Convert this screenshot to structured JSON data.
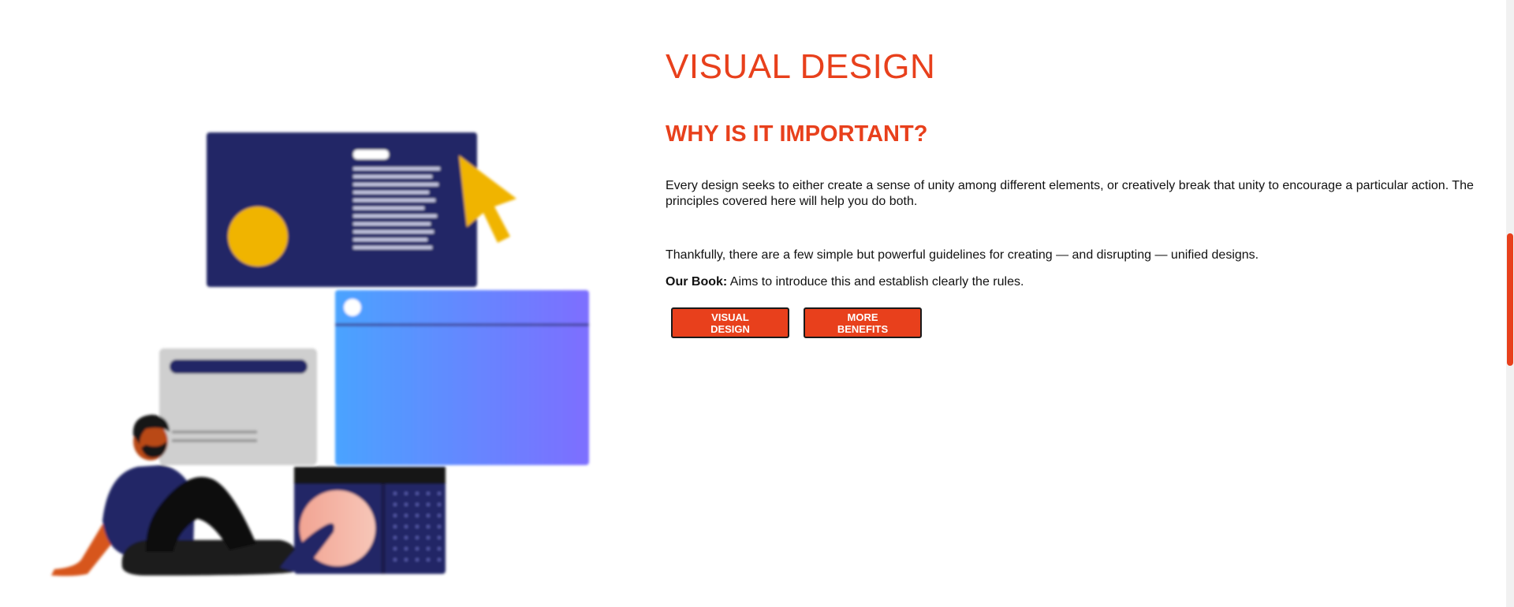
{
  "theme": {
    "accent": "#e8401c",
    "navy": "#242766",
    "yellow": "#f0b400",
    "blue": "#4aa3ff",
    "purple": "#7d6eff",
    "gray": "#cfcfcf",
    "skin": "#d7561e",
    "pink": "#f2a493"
  },
  "section": {
    "title": "VISUAL DESIGN",
    "subtitle": "WHY IS IT IMPORTANT?",
    "paragraph1": "Every design seeks to either create a sense of unity among different elements, or creatively break that unity to encourage a particular action. The principles covered here will help you do both.",
    "paragraph2": "Thankfully, there are a few simple but powerful guidelines for creating — and disrupting — unified designs.",
    "book_label": "Our Book:",
    "book_text": " Aims to introduce this and establish clearly the rules."
  },
  "buttons": {
    "primary_label": "VISUAL DESIGN",
    "secondary_label": "MORE BENEFITS"
  },
  "illustration": {
    "icons": [
      "presentation-board-icon",
      "cursor-arrow-icon",
      "browser-window-icon",
      "card-icon",
      "person-icon",
      "device-icon"
    ]
  }
}
